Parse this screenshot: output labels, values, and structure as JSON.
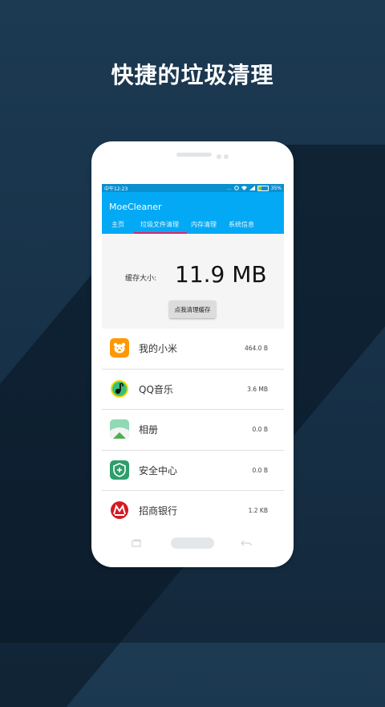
{
  "headline": "快捷的垃圾清理",
  "status_bar": {
    "time": "中午12:23",
    "icons_left": "...",
    "battery": "35%"
  },
  "app": {
    "title": "MoeCleaner",
    "tabs": [
      {
        "label": "主页",
        "active": false
      },
      {
        "label": "垃圾文件清理",
        "active": true
      },
      {
        "label": "内存清理",
        "active": false
      },
      {
        "label": "系统信息",
        "active": false
      }
    ],
    "accent_color": "#03a9f4",
    "tab_indicator_color": "#e91e63"
  },
  "cache": {
    "label": "缓存大小:",
    "value": "11.9 MB"
  },
  "clean_button": {
    "label": "点我清理缓存"
  },
  "apps": [
    {
      "name": "我的小米",
      "size": "464.0 B",
      "icon": "mi-bear-icon"
    },
    {
      "name": "QQ音乐",
      "size": "3.6 MB",
      "icon": "qq-music-icon"
    },
    {
      "name": "相册",
      "size": "0.0 B",
      "icon": "gallery-icon"
    },
    {
      "name": "安全中心",
      "size": "0.0 B",
      "icon": "security-center-icon"
    },
    {
      "name": "招商银行",
      "size": "1.2 KB",
      "icon": "cmb-bank-icon"
    }
  ]
}
